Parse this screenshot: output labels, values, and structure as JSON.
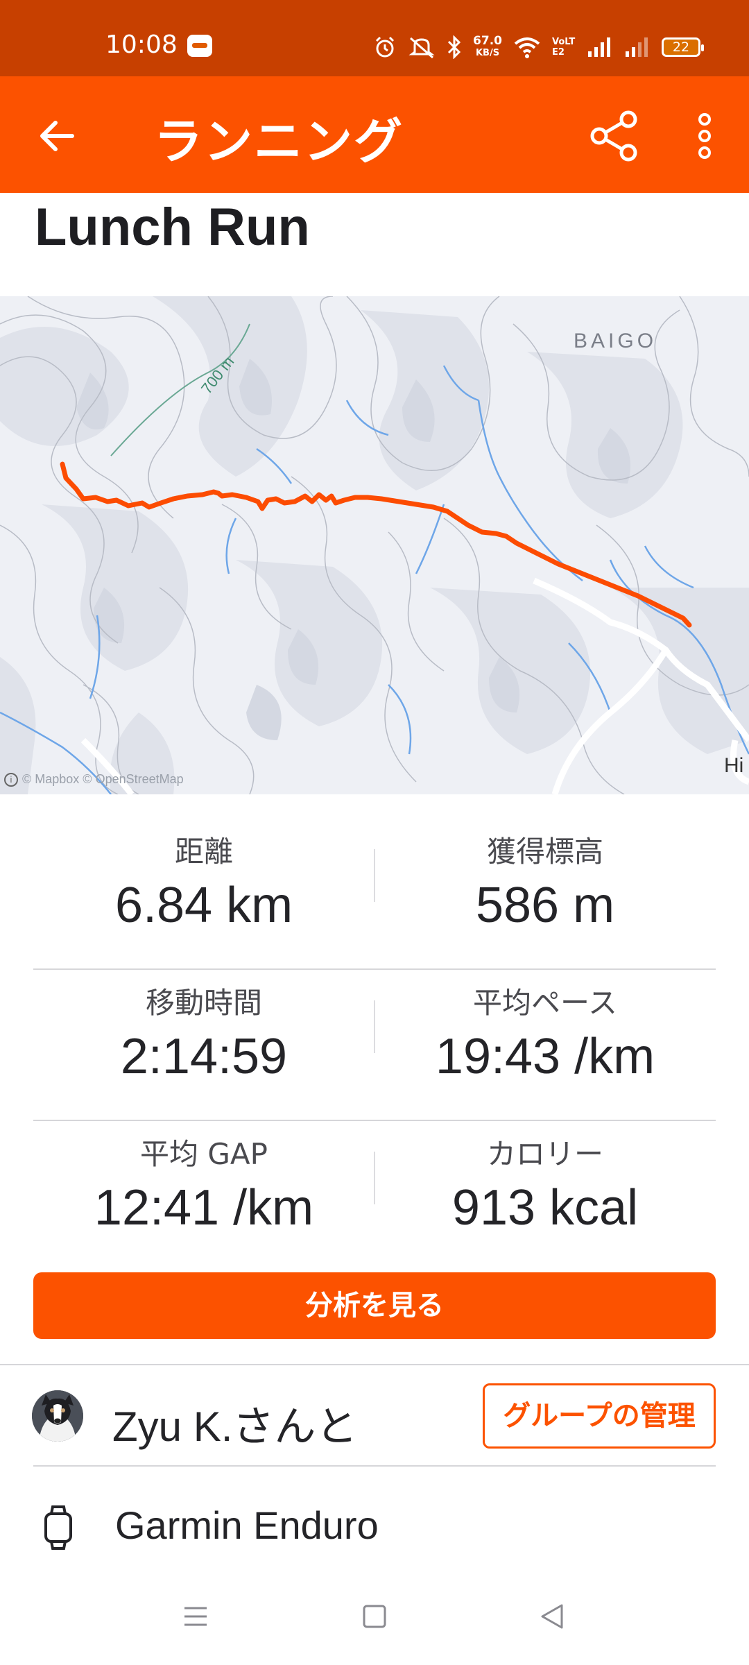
{
  "status_bar": {
    "time": "10:08",
    "net_speed_value": "67.0",
    "net_speed_unit": "KB/S",
    "volte": "VoLTE2",
    "battery": "22"
  },
  "app_bar": {
    "title": "ランニング",
    "icons": [
      "back-arrow-icon",
      "share-icon",
      "more-vert-icon"
    ]
  },
  "activity": {
    "title": "Lunch Run"
  },
  "map": {
    "label_area": "BAIGO",
    "label_elevation": "700 m",
    "label_edge": "Hi",
    "attribution": "© Mapbox © OpenStreetMap",
    "route_color": "#fc5200"
  },
  "stats": [
    {
      "left": {
        "label": "距離",
        "value": "6.84 km"
      },
      "right": {
        "label": "獲得標高",
        "value": "586 m"
      }
    },
    {
      "left": {
        "label": "移動時間",
        "value": "2:14:59"
      },
      "right": {
        "label": "平均ペース",
        "value": "19:43 /km"
      }
    },
    {
      "left": {
        "label": "平均 GAP",
        "value": "12:41 /km"
      },
      "right": {
        "label": "カロリー",
        "value": "913 kcal"
      }
    }
  ],
  "analyze_button": "分析を見る",
  "group": {
    "text": "Zyu K.さんと",
    "manage_button": "グループの管理"
  },
  "device": {
    "name": "Garmin Enduro"
  },
  "colors": {
    "brand": "#fc5200",
    "status_bar": "#c74000"
  }
}
